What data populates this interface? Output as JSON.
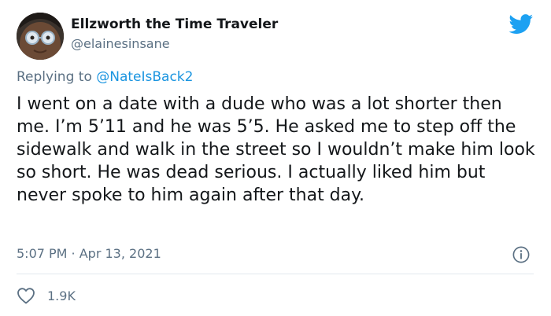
{
  "tweet": {
    "author": {
      "display_name": "Ellzworth the Time Traveler",
      "handle": "@elainesinsane",
      "avatar_icon": "profile-photo"
    },
    "platform_icon": "twitter-bird-icon",
    "reply": {
      "prefix": "Replying to ",
      "mention": "@NateIsBack2"
    },
    "text": "I went on a date with a dude who was a lot shorter then me. I’m 5’11 and he was 5’5. He asked me to step off the sidewalk and walk in the street so I wouldn’t make him look so short. He was dead serious. I actually liked him but never spoke to him again after that day.",
    "timestamp": "5:07 PM · Apr 13, 2021",
    "info_icon": "info-icon",
    "likes": {
      "icon": "heart-icon",
      "count": "1.9K"
    }
  },
  "colors": {
    "brand_blue": "#1da1f2",
    "mention_blue": "#1b95e0",
    "secondary_text": "#5b7083",
    "primary_text": "#14171a",
    "divider": "#e1e8ed"
  }
}
